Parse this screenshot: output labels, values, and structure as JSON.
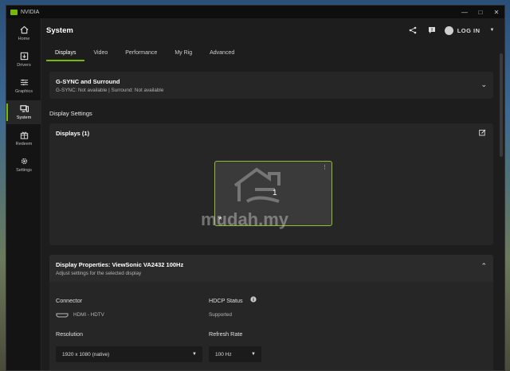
{
  "titlebar": {
    "app_name": "NVIDIA",
    "minimize": "—",
    "maximize": "□",
    "close": "✕"
  },
  "sidebar": {
    "items": [
      {
        "label": "Home",
        "icon": "home-icon"
      },
      {
        "label": "Drivers",
        "icon": "download-icon"
      },
      {
        "label": "Graphics",
        "icon": "sliders-icon"
      },
      {
        "label": "System",
        "icon": "monitor-icon",
        "active": true
      },
      {
        "label": "Redeem",
        "icon": "gift-icon"
      },
      {
        "label": "Settings",
        "icon": "gear-icon"
      }
    ]
  },
  "header": {
    "title": "System",
    "login_label": "LOG IN"
  },
  "tabs": [
    {
      "label": "Displays",
      "active": true
    },
    {
      "label": "Video"
    },
    {
      "label": "Performance"
    },
    {
      "label": "My Rig"
    },
    {
      "label": "Advanced"
    }
  ],
  "gsync": {
    "title": "G-SYNC and Surround",
    "subtitle": "G-SYNC: Not available | Surround: Not available"
  },
  "display_settings": {
    "section_title": "Display Settings",
    "displays_title": "Displays (1)",
    "monitor_number": "1",
    "primary_marker": "*"
  },
  "watermark": {
    "text": "mudah.my"
  },
  "properties": {
    "title": "Display Properties: ViewSonic VA2432 100Hz",
    "subtitle": "Adjust settings for the selected display",
    "connector_label": "Connector",
    "connector_value": "HDMI - HDTV",
    "hdcp_label": "HDCP Status",
    "hdcp_value": "Supported",
    "resolution_label": "Resolution",
    "resolution_value": "1920 x 1080 (native)",
    "refresh_label": "Refresh Rate",
    "refresh_value": "100 Hz"
  },
  "colors": {
    "accent": "#76b900",
    "background": "#1d1d1d",
    "panel": "#262626"
  }
}
